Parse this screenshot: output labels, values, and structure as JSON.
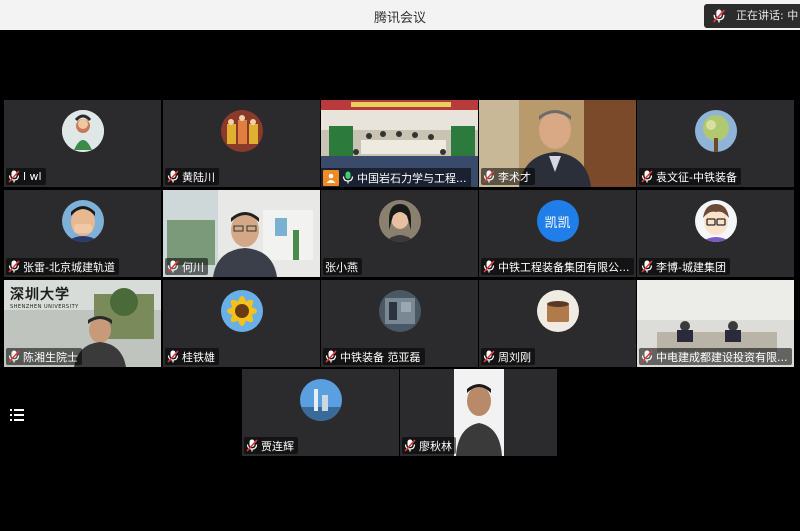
{
  "app": {
    "title": "腾讯会议"
  },
  "speaking": {
    "label": "正在讲话: 中"
  },
  "participants": [
    {
      "name": "l wl"
    },
    {
      "name": "黄陆川"
    },
    {
      "name": "中国岩石力学与工程..."
    },
    {
      "name": "李术才"
    },
    {
      "name": "袁文征-中铁装备"
    },
    {
      "name": "张雷-北京城建轨道"
    },
    {
      "name": "何川"
    },
    {
      "name": "张小燕"
    },
    {
      "name": "中铁工程装备集团有限公..."
    },
    {
      "name": "李博-城建集团"
    },
    {
      "name": "陈湘生院士"
    },
    {
      "name": "桂铁雄"
    },
    {
      "name": "中铁装备 范亚磊"
    },
    {
      "name": "周刘刚"
    },
    {
      "name": "中电建成都建设投资有限..."
    },
    {
      "name": "贾连辉"
    },
    {
      "name": "廖秋林"
    }
  ],
  "avatars": {
    "kaikai_text": "凯凯",
    "shenzhen_sign": "深圳大学",
    "shenzhen_sign_en": "SHENZHEN UNIVERSITY"
  },
  "colors": {
    "tile_bg": "#2b2b2d",
    "mic_green": "#3bd16f",
    "host_orange": "#f08a24"
  },
  "icons": {
    "mic": "microphone-icon",
    "menu": "menu-icon",
    "host": "person-icon"
  }
}
